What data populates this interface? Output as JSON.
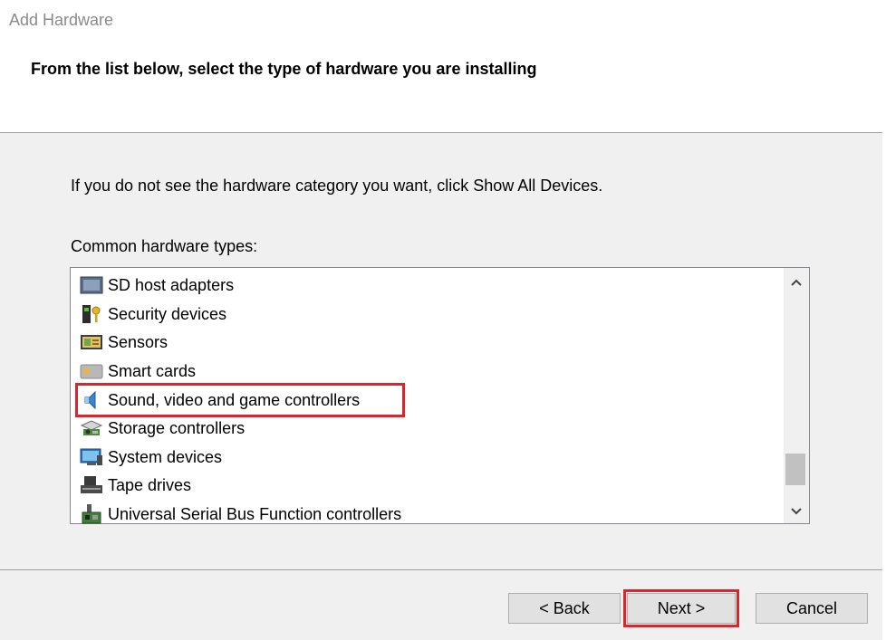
{
  "window": {
    "title": "Add Hardware",
    "heading": "From the list below, select the type of hardware you are installing"
  },
  "main": {
    "instruction": "If you do not see the hardware category you want, click Show All Devices.",
    "list_label": "Common hardware types:",
    "items": [
      {
        "label": "SD host adapters",
        "icon": "sd-adapter-icon"
      },
      {
        "label": "Security devices",
        "icon": "security-device-icon"
      },
      {
        "label": "Sensors",
        "icon": "sensor-icon"
      },
      {
        "label": "Smart cards",
        "icon": "smart-card-icon"
      },
      {
        "label": "Sound, video and game controllers",
        "icon": "speaker-icon"
      },
      {
        "label": "Storage controllers",
        "icon": "storage-controller-icon"
      },
      {
        "label": "System devices",
        "icon": "system-device-icon"
      },
      {
        "label": "Tape drives",
        "icon": "tape-drive-icon"
      },
      {
        "label": "Universal Serial Bus Function controllers",
        "icon": "usb-controller-icon"
      }
    ]
  },
  "footer": {
    "back_label": "< Back",
    "next_label": "Next >",
    "cancel_label": "Cancel"
  },
  "colors": {
    "highlight": "#d9262c",
    "background": "#f0f0f0"
  }
}
